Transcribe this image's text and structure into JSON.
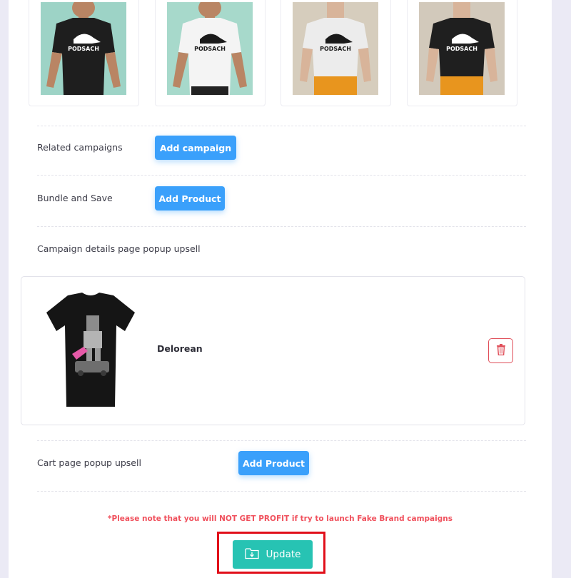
{
  "mockups": [
    {
      "bg": "#9dd3c6",
      "shirt": "#1e1e1e",
      "print_color": "#ffffff",
      "skin": "#b98564",
      "brand": "PODSACH"
    },
    {
      "bg": "#a7d9cb",
      "shirt": "#f4f4f4",
      "print_color": "#1a1a1a",
      "skin": "#b98564",
      "brand": "PODSACH"
    },
    {
      "bg": "#d6cdbd",
      "shirt": "#ececec",
      "print_color": "#1a1a1a",
      "skin": "#d8b49a",
      "brand": "PODSACH"
    },
    {
      "bg": "#d2c9bb",
      "shirt": "#1f1f1f",
      "print_color": "#ffffff",
      "skin": "#d8b49a",
      "brand": "PODSACH"
    }
  ],
  "sections": {
    "related_campaigns": {
      "label": "Related campaigns",
      "button": "Add campaign"
    },
    "bundle_and_save": {
      "label": "Bundle and Save",
      "button": "Add Product"
    },
    "campaign_popup": {
      "label": "Campaign details page popup upsell"
    },
    "cart_popup": {
      "label": "Cart page popup upsell",
      "button": "Add Product"
    }
  },
  "upsell_product": {
    "name": "Delorean",
    "icon": "trash-icon"
  },
  "warning_text": "*Please note that you will NOT GET PROFIT if try to launch Fake Brand campaigns",
  "update_button": {
    "label": "Update",
    "icon": "folder-download-icon"
  },
  "colors": {
    "primary_blue": "#3aa0fb",
    "teal": "#27c3b3",
    "danger": "#e0505a"
  }
}
